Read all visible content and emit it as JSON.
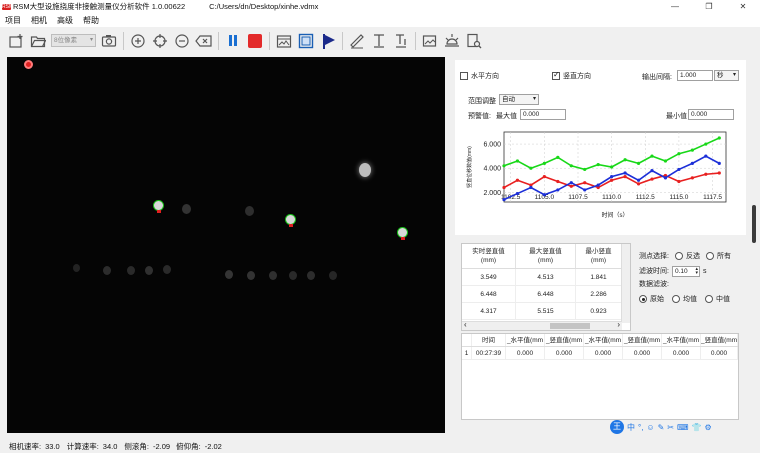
{
  "window": {
    "logo": "RSM",
    "title": "RSM大型设施挠度非接触测量仪分析软件 1.0.00622",
    "path": "C:/Users/dn/Desktop/xinhe.vdmx",
    "minimize": "—",
    "restore": "❐",
    "close": "✕"
  },
  "menu": [
    "项目",
    "相机",
    "高级",
    "帮助"
  ],
  "toolbar": {
    "pixel_mode": "8位像素",
    "icons": [
      "new-project-icon",
      "open-folder-icon",
      "camera-icon",
      "add-point-icon",
      "target-icon",
      "remove-point-icon",
      "clear-icon",
      "pause-icon",
      "stop-icon",
      "image-icon",
      "picture-frame-icon",
      "flag-icon",
      "ruler-icon",
      "text-tool-icon",
      "text-align-icon",
      "image-edit-icon",
      "brightness-icon",
      "document-search-icon"
    ]
  },
  "status": {
    "camera_rate_label": "相机速率:",
    "camera_rate": "33.0",
    "compute_rate_label": "计算速率:",
    "compute_rate": "34.0",
    "roll_label": "侧滚角:",
    "roll": "-2.09",
    "pitch_label": "俯仰角:",
    "pitch": "-2.02"
  },
  "settings": {
    "horizontal_label": "水平方向",
    "horizontal_checked": false,
    "vertical_label": "竖直方向",
    "vertical_checked": true,
    "output_interval_label": "输出间隔:",
    "output_interval": "1.000",
    "output_unit": "秒",
    "range_label": "范围调整",
    "range_value": "自动",
    "alarm_label": "预警值:",
    "max_label": "最大值",
    "max_value": "0.000",
    "min_label": "最小值",
    "min_value": "0.000"
  },
  "chart_data": {
    "type": "line",
    "ylabel": "竖直位移数值(mm)",
    "xlabel": "时间（s）",
    "xlim": [
      1102,
      1118.5
    ],
    "ylim": [
      1.2,
      7.0
    ],
    "xticks": [
      1102.5,
      1105.0,
      1107.5,
      1110.0,
      1112.5,
      1115.0,
      1117.5
    ],
    "xtick_labels": [
      "1102.5",
      "1105.0",
      "1107.5",
      "1110.0",
      "1112.5",
      "1115.0",
      "1117.5"
    ],
    "yticks": [
      2.0,
      4.0,
      6.0
    ],
    "ytick_labels": [
      "2.000",
      "4.000",
      "6.000"
    ],
    "grid": true,
    "series": [
      {
        "color": "#18d818",
        "x": [
          1102,
          1103,
          1104,
          1105,
          1106,
          1107,
          1108,
          1109,
          1110,
          1111,
          1112,
          1113,
          1114,
          1115,
          1116,
          1117,
          1118
        ],
        "y": [
          4.2,
          4.6,
          4.0,
          4.4,
          4.9,
          4.2,
          3.9,
          4.3,
          4.1,
          4.7,
          4.4,
          5.0,
          4.6,
          5.2,
          5.5,
          6.0,
          6.5
        ]
      },
      {
        "color": "#e82020",
        "x": [
          1102,
          1103,
          1104,
          1105,
          1106,
          1107,
          1108,
          1109,
          1110,
          1111,
          1112,
          1113,
          1114,
          1115,
          1116,
          1117,
          1118
        ],
        "y": [
          2.4,
          3.0,
          2.6,
          3.3,
          2.9,
          2.5,
          2.8,
          2.4,
          3.0,
          3.3,
          2.7,
          3.1,
          3.4,
          2.9,
          3.2,
          3.5,
          3.6
        ]
      },
      {
        "color": "#1c2fd8",
        "x": [
          1102,
          1103,
          1104,
          1105,
          1106,
          1107,
          1108,
          1109,
          1110,
          1111,
          1112,
          1113,
          1114,
          1115,
          1116,
          1117,
          1118
        ],
        "y": [
          1.4,
          1.9,
          2.4,
          1.8,
          2.2,
          2.8,
          2.2,
          2.6,
          3.3,
          3.6,
          3.0,
          3.8,
          3.2,
          3.9,
          4.4,
          5.0,
          4.4
        ]
      }
    ]
  },
  "realtime_table": {
    "headers": [
      "实时竖直值\n(mm)",
      "最大竖直值\n(mm)",
      "最小竖直\n(mm)"
    ],
    "rows": [
      [
        "3.549",
        "4.513",
        "1.841"
      ],
      [
        "6.448",
        "6.448",
        "2.286"
      ],
      [
        "4.317",
        "5.515",
        "0.923"
      ]
    ],
    "scroll_left": "‹",
    "scroll_right": "›"
  },
  "measure": {
    "point_select_label": "测点选择:",
    "invert_label": "反选",
    "all_label": "所有",
    "filter_time_label": "滤波时间:",
    "filter_time": "0.10",
    "filter_unit": "s",
    "data_filter_label": "数据滤波:",
    "raw_label": "原始",
    "mean_label": "均值",
    "median_label": "中值",
    "selected": "原始"
  },
  "log_table": {
    "headers": [
      "时间",
      "_水平值(mm",
      "_竖直值(mm",
      "_水平值(mm",
      "_竖直值(mm",
      "_水平值(mm",
      "_竖直值(mm"
    ],
    "rows": [
      [
        "1",
        "00:27:39",
        "0.000",
        "0.000",
        "0.000",
        "0.000",
        "0.000",
        "0.000"
      ]
    ]
  },
  "tray": {
    "ime": "王",
    "items": [
      "中",
      "°,",
      "☺",
      "✎",
      "✂",
      "⌨",
      "👕",
      "⚙"
    ]
  }
}
